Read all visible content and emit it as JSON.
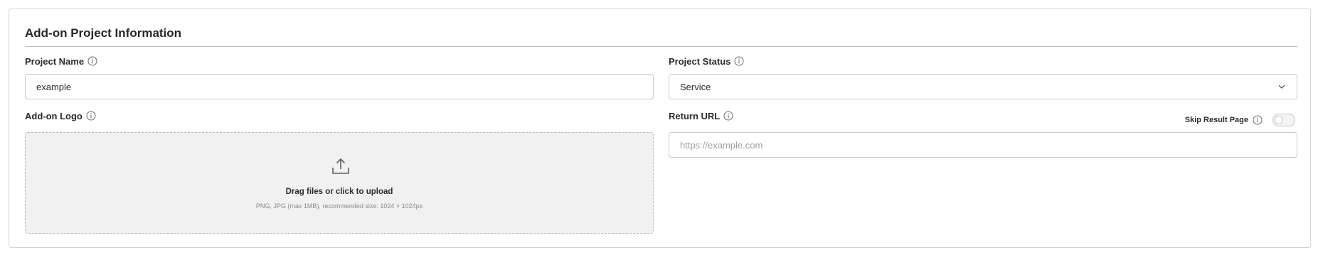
{
  "section": {
    "title": "Add-on Project Information"
  },
  "project_name": {
    "label": "Project Name",
    "value": "example"
  },
  "project_status": {
    "label": "Project Status",
    "selected": "Service"
  },
  "addon_logo": {
    "label": "Add-on Logo",
    "upload_title": "Drag files or click to upload",
    "upload_hint": "PNG, JPG (max 1MB), recommended size: 1024 × 1024px"
  },
  "return_url": {
    "label": "Return URL",
    "placeholder": "https://example.com",
    "value": ""
  },
  "skip_result_page": {
    "label": "Skip Result Page",
    "enabled": false
  },
  "icons": {
    "info": "info-circle-icon",
    "chevron": "chevron-down-icon",
    "upload": "upload-icon"
  }
}
